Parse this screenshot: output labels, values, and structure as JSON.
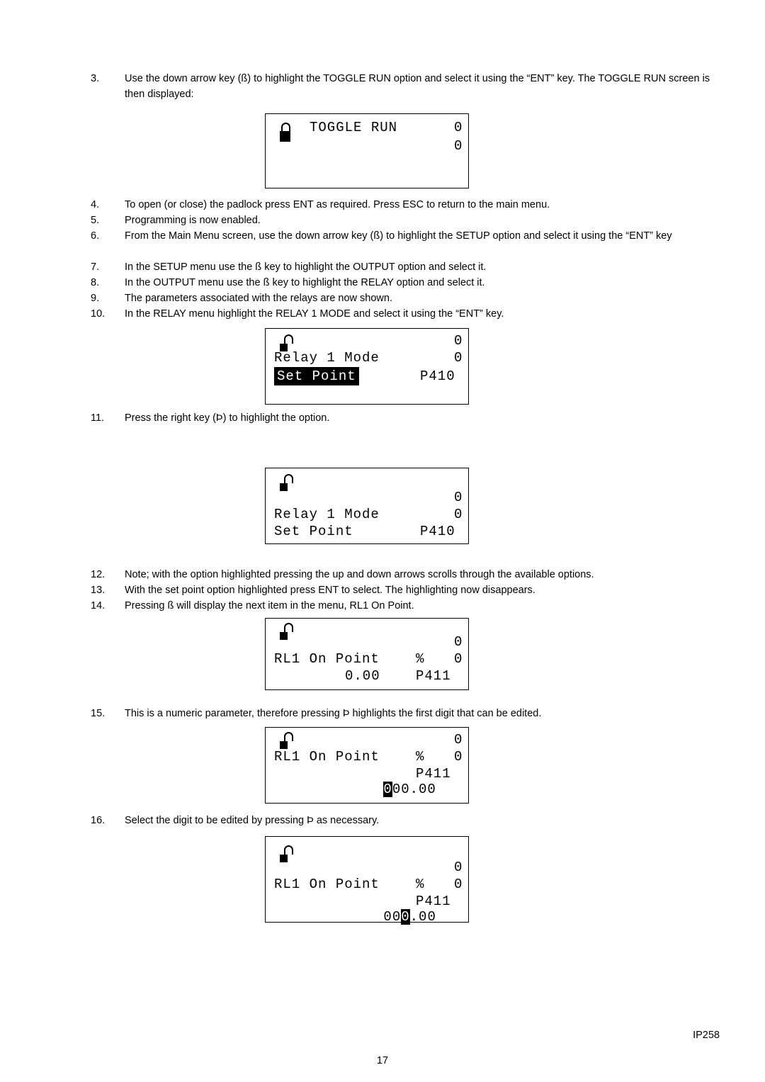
{
  "document": {
    "page_number": "17",
    "footer_code": "IP258"
  },
  "steps": [
    {
      "num": "3.",
      "text": "Use the down arrow key (ß) to highlight the TOGGLE RUN option and select it using the “ENT” key. The TOGGLE RUN screen is then displayed:"
    },
    {
      "num": "4.",
      "text": "To open (or close) the padlock press ENT as required. Press ESC to return to the main menu."
    },
    {
      "num": "5.",
      "text": "Programming is now enabled."
    },
    {
      "num": "6.",
      "text": "From the Main Menu screen, use the down arrow key (ß) to highlight the SETUP option and select it using the “ENT” key"
    },
    {
      "num": "7.",
      "text": "In the SETUP menu use the ß key to highlight the OUTPUT option and select it."
    },
    {
      "num": "8.",
      "text": "In the OUTPUT menu use the ß key to highlight the RELAY option and select it."
    },
    {
      "num": "9.",
      "text": "The parameters associated with the relays are now shown."
    },
    {
      "num": "10.",
      "text": "In the RELAY menu highlight the RELAY 1 MODE and select it using the “ENT” key."
    },
    {
      "num": "11.",
      "text": "Press the right key (Þ) to highlight the option."
    },
    {
      "num": "12.",
      "text": "Note; with the option highlighted pressing the up and down arrows scrolls through the available options."
    },
    {
      "num": "13.",
      "text": "With the set point option highlighted press ENT to select. The highlighting now disappears."
    },
    {
      "num": "14.",
      "text": "Pressing ß will display the next item in the menu, RL1 On Point."
    },
    {
      "num": "15.",
      "text": "This is a numeric parameter, therefore pressing Þ highlights the first digit that can be edited."
    },
    {
      "num": "16.",
      "text": "Select the digit to be edited by pressing Þ as necessary."
    }
  ],
  "screens": {
    "toggle_run": {
      "title": "TOGGLE RUN",
      "value_top": "0",
      "value_second": "0",
      "lock_state": "closed"
    },
    "relay_mode_unhighlighted": {
      "value_top": "0",
      "line_label": "Relay 1 Mode",
      "value_second": "0",
      "option": "Set Point",
      "param": "P410",
      "lock_state": "open",
      "highlight": "option"
    },
    "relay_mode_highlighted": {
      "value_top": "0",
      "line_label": "Relay 1 Mode",
      "value_second": "0",
      "option": "Set Point",
      "param": "P410",
      "lock_state": "open",
      "highlight": "none"
    },
    "rl1_on_point": {
      "value_top": "0",
      "line_label": "RL1 On Point",
      "unit": "%",
      "value_second": "0",
      "value": "0.00",
      "param": "P411",
      "lock_state": "open"
    },
    "rl1_on_point_digit1": {
      "value_top": "0",
      "line_label": "RL1 On Point",
      "unit": "%",
      "value_second": "0",
      "digit_highlighted": "0",
      "value_rest": "00.00",
      "param": "P411",
      "lock_state": "open"
    },
    "rl1_on_point_digit3": {
      "value_top": "0",
      "line_label": "RL1 On Point",
      "unit": "%",
      "value_second": "0",
      "value_prefix": "00",
      "digit_highlighted": "0",
      "value_suffix": ".00",
      "param": "P411",
      "lock_state": "open"
    }
  }
}
